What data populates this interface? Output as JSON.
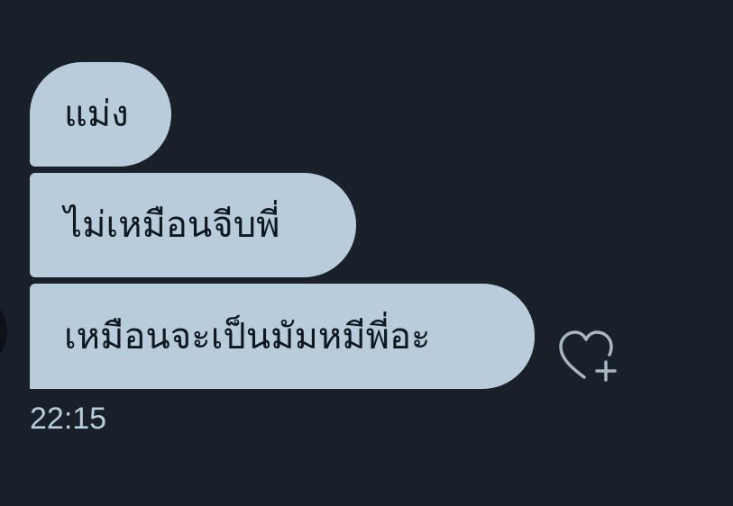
{
  "messages": [
    {
      "text": "แม่ง"
    },
    {
      "text": "ไม่เหมือนจีบพี่"
    },
    {
      "text": "เหมือนจะเป็นมัมหมีพี่อะ"
    }
  ],
  "timestamp": "22:15",
  "reaction_icon": "heart-plus-icon",
  "colors": {
    "background": "#19202a",
    "bubble": "#b9ccdb",
    "bubble_text": "#0f1720",
    "timestamp": "#b9ccdb",
    "icon": "#a7b6c2"
  }
}
